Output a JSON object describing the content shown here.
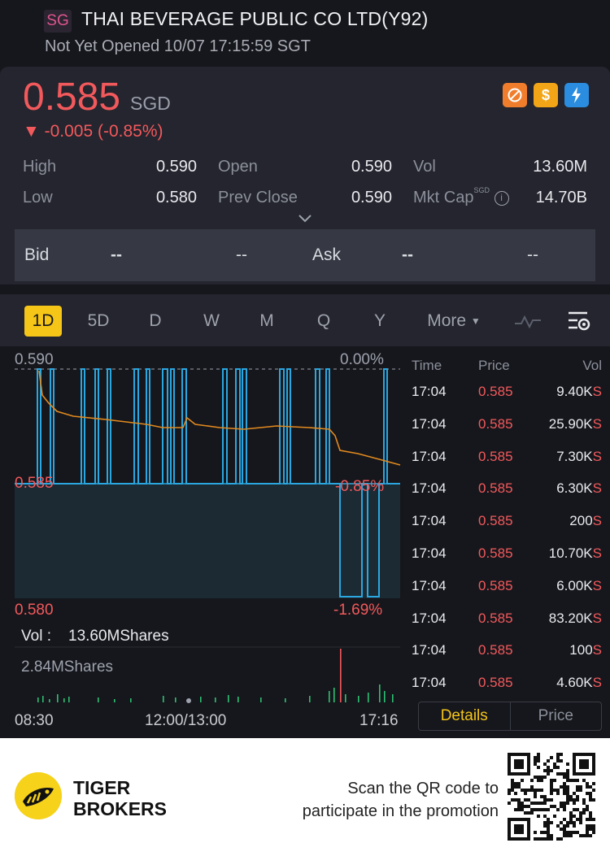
{
  "header": {
    "market_badge": "SG",
    "title": "THAI BEVERAGE PUBLIC CO LTD(Y92)",
    "status": "Not Yet Opened 10/07 17:15:59 SGT"
  },
  "quote": {
    "price": "0.585",
    "currency": "SGD",
    "change": "▼ -0.005 (-0.85%)",
    "icons": [
      "no-short-icon",
      "dollar-icon",
      "lightning-icon"
    ],
    "stats": {
      "high_label": "High",
      "high_value": "0.590",
      "open_label": "Open",
      "open_value": "0.590",
      "vol_label": "Vol",
      "vol_value": "13.60M",
      "low_label": "Low",
      "low_value": "0.580",
      "prev_close_label": "Prev Close",
      "prev_close_value": "0.590",
      "mkt_cap_label": "Mkt Cap",
      "mkt_cap_sup": "SGD",
      "mkt_cap_value": "14.70B"
    },
    "bid_label": "Bid",
    "bid_price": "--",
    "bid_size": "--",
    "ask_label": "Ask",
    "ask_price": "--",
    "ask_size": "--"
  },
  "tabs": {
    "items": [
      "1D",
      "5D",
      "D",
      "W",
      "M",
      "Q",
      "Y"
    ],
    "more": "More",
    "active": "1D"
  },
  "chart": {
    "top_price": "0.590",
    "top_pct": "0.00%",
    "mid_price": "0.585",
    "mid_pct": "-0.85%",
    "bottom_price": "0.580",
    "bottom_pct": "-1.69%",
    "vol_label": "Vol :",
    "vol_value": "13.60MShares",
    "vol_max": "2.84MShares",
    "time_start": "08:30",
    "time_mid": "12:00/13:00",
    "time_end": "17:16",
    "colors": {
      "price_line": "#2aa7e0",
      "avg_line": "#e28a1f",
      "up": "#f2595c",
      "down": "#2fbf71"
    }
  },
  "trades": {
    "headers": {
      "time": "Time",
      "price": "Price",
      "vol": "Vol"
    },
    "rows": [
      {
        "time": "17:04",
        "price": "0.585",
        "vol": "9.40K",
        "side": "S"
      },
      {
        "time": "17:04",
        "price": "0.585",
        "vol": "25.90K",
        "side": "S"
      },
      {
        "time": "17:04",
        "price": "0.585",
        "vol": "7.30K",
        "side": "S"
      },
      {
        "time": "17:04",
        "price": "0.585",
        "vol": "6.30K",
        "side": "S"
      },
      {
        "time": "17:04",
        "price": "0.585",
        "vol": "200",
        "side": "S"
      },
      {
        "time": "17:04",
        "price": "0.585",
        "vol": "10.70K",
        "side": "S"
      },
      {
        "time": "17:04",
        "price": "0.585",
        "vol": "6.00K",
        "side": "S"
      },
      {
        "time": "17:04",
        "price": "0.585",
        "vol": "83.20K",
        "side": "S"
      },
      {
        "time": "17:04",
        "price": "0.585",
        "vol": "100",
        "side": "S"
      },
      {
        "time": "17:04",
        "price": "0.585",
        "vol": "4.60K",
        "side": "S"
      }
    ],
    "details_label": "Details",
    "price_label": "Price"
  },
  "promo": {
    "brand_line1": "TIGER",
    "brand_line2": "BROKERS",
    "text_line1": "Scan the QR code to",
    "text_line2": "participate in the promotion"
  }
}
